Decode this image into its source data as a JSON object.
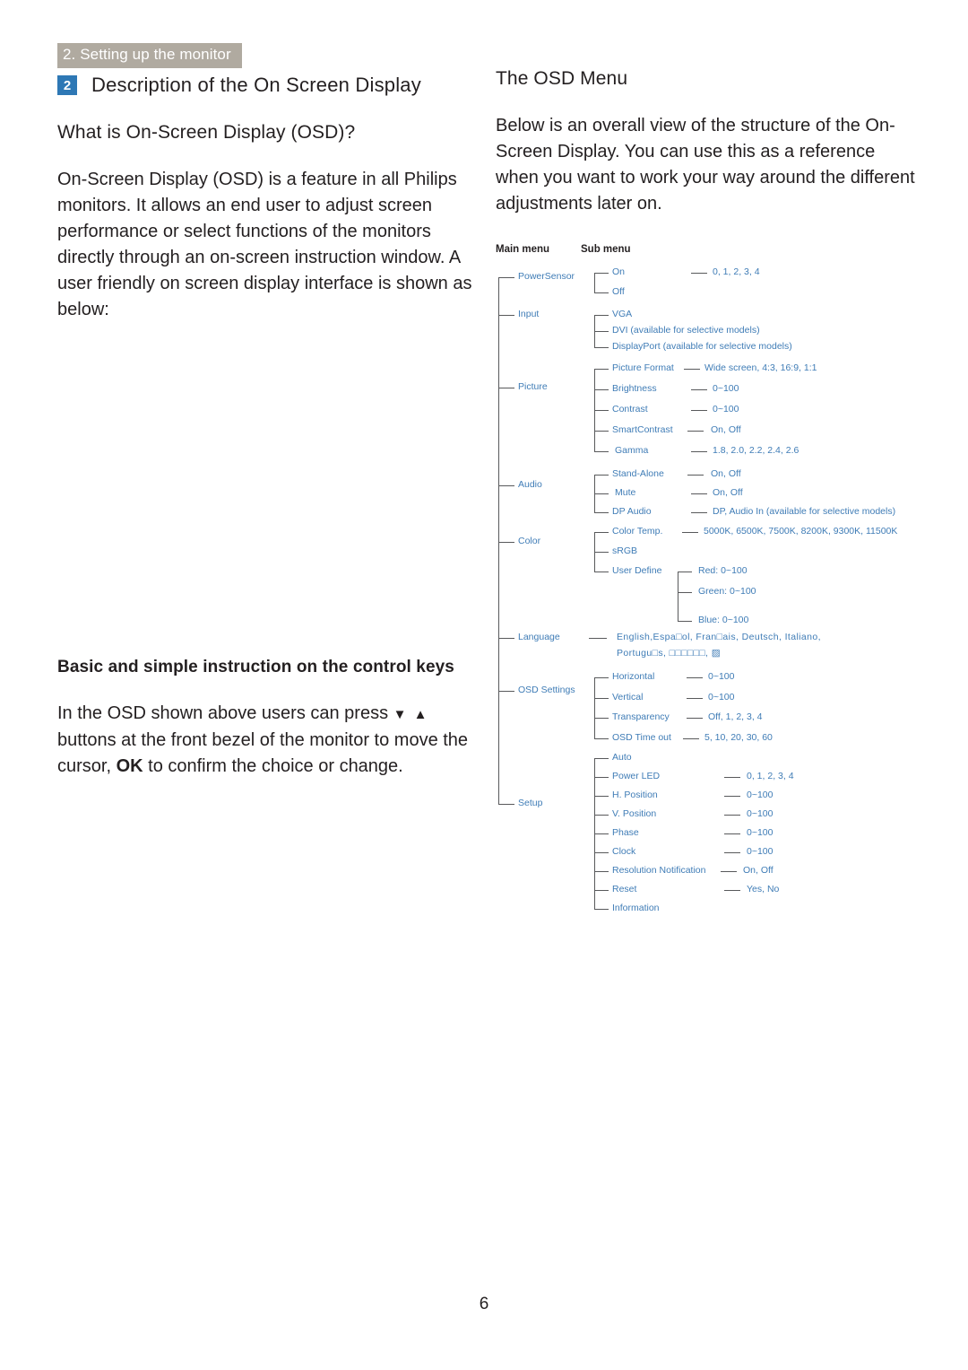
{
  "header": {
    "running_head": "2. Setting up the monitor"
  },
  "section": {
    "badge": "2",
    "title": "Description of the On Screen Display"
  },
  "left_column": {
    "heading_osd": "What is On-Screen Display (OSD)?",
    "paragraph_osd": "On-Screen Display (OSD) is a feature in all Philips monitors. It allows an end user to adjust screen performance or select functions of the monitors directly through an on-screen instruction window. A user friendly on screen display interface is shown as below:",
    "heading_keys": "Basic and simple instruction on the control keys",
    "keys_text_1": "In the OSD shown above users can press ",
    "keys_arrows": "▼ ▲",
    "keys_text_2": " buttons at the front bezel of the monitor to move the cursor, ",
    "keys_ok": "OK",
    "keys_text_3": " to confirm the choice or change."
  },
  "right_column": {
    "heading_menu": "The OSD Menu",
    "paragraph_menu": "Below is an overall view of the structure of the On-Screen Display. You can use this as a reference when you want to work your way around the different adjustments later on."
  },
  "diagram": {
    "column_headers": {
      "main": "Main menu",
      "sub": "Sub menu"
    },
    "main_items": [
      "PowerSensor",
      "Input",
      "Picture",
      "Audio",
      "Color",
      "Language",
      "OSD Settings",
      "Setup"
    ],
    "sub_items": {
      "powersensor": [
        "On",
        "Off"
      ],
      "input": [
        "VGA",
        "DVI (available for selective models)",
        "DisplayPort (available for selective models)"
      ],
      "picture": [
        "Picture Format",
        "Brightness",
        "Contrast",
        "SmartContrast",
        "Gamma"
      ],
      "audio": [
        "Stand-Alone",
        "Mute",
        "DP Audio"
      ],
      "color": [
        "Color Temp.",
        "sRGB",
        "User Define"
      ],
      "color_user_define": [
        "Red: 0~100",
        "Green: 0~100",
        "Blue: 0~100"
      ],
      "language": [
        "English,Espa□ol, Fran□ais, Deutsch, Italiano,",
        "Portugu□s, □□□□□□, ▨"
      ],
      "osd_settings": [
        "Horizontal",
        "Vertical",
        "Transparency",
        "OSD Time out"
      ],
      "setup": [
        "Auto",
        "Power LED",
        "H. Position",
        "V. Position",
        "Phase",
        "Clock",
        "Resolution Notification",
        "Reset",
        "Information"
      ]
    },
    "values": {
      "powersensor_on": "0, 1, 2, 3, 4",
      "picture_format": "Wide screen, 4:3, 16:9, 1:1",
      "brightness": "0~100",
      "contrast": "0~100",
      "smartcontrast": "On, Off",
      "gamma": "1.8, 2.0, 2.2, 2.4, 2.6",
      "stand_alone": "On, Off",
      "mute": "On, Off",
      "dp_audio": "DP, Audio In (available for selective models)",
      "color_temp": "5000K, 6500K, 7500K, 8200K, 9300K, 11500K",
      "horizontal": "0~100",
      "vertical": "0~100",
      "transparency": "Off, 1, 2, 3, 4",
      "osd_time_out": "5, 10, 20, 30, 60",
      "power_led": "0, 1, 2, 3, 4",
      "h_position": "0~100",
      "v_position": "0~100",
      "phase": "0~100",
      "clock": "0~100",
      "resolution_notification": "On, Off",
      "reset": "Yes, No"
    }
  },
  "footer": {
    "page_number": "6"
  },
  "colors": {
    "header_band": "#b0aaa0",
    "badge_blue": "#2e78b5",
    "diagram_blue": "#3f7cb6",
    "line_gray": "#58595b",
    "text_black": "#231f20"
  }
}
